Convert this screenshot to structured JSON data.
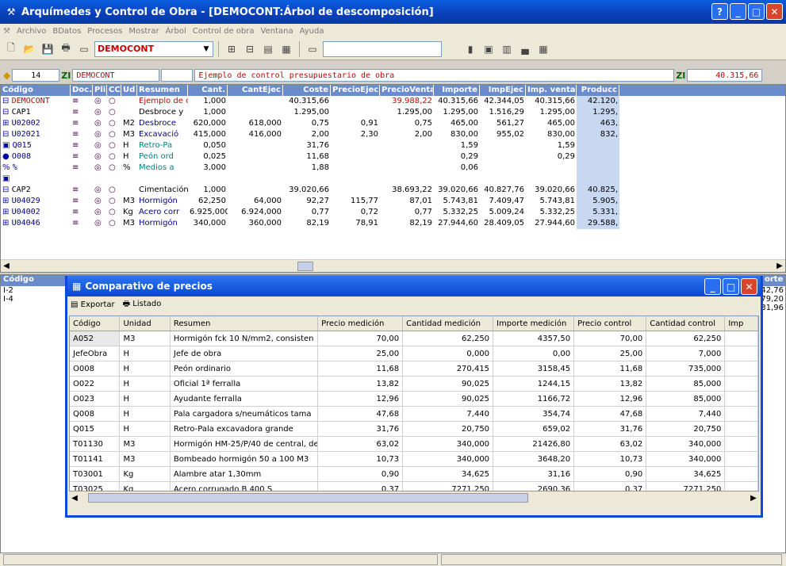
{
  "window": {
    "title": "Arquímedes y Control de Obra - [DEMOCONT:Árbol de descomposición]"
  },
  "menu": [
    "Archivo",
    "BDatos",
    "Procesos",
    "Mostrar",
    "Árbol",
    "Control de obra",
    "Ventana",
    "Ayuda"
  ],
  "toolbar": {
    "project": "DEMOCONT"
  },
  "infobar": {
    "level": "14",
    "code": "DEMOCONT",
    "summary": "Ejemplo de control presupuestario de obra",
    "total": "40.315,66"
  },
  "tree": {
    "columns": [
      "Código",
      "Doc.",
      "Pli.",
      "CC",
      "Ud",
      "Resumen",
      "Cant.",
      "CantEjec",
      "Coste",
      "PrecioEjec",
      "PrecioVenta",
      "Importe",
      "ImpEjec",
      "Imp. venta",
      "Producc"
    ],
    "rows": [
      {
        "code": "DEMOCONT",
        "ud": "",
        "res": "Ejemplo de co",
        "cant": "1,000",
        "cantejec": "",
        "coste": "40.315,66",
        "pe": "",
        "pv": "39.988,22",
        "imp": "40.315,66",
        "impejec": "42.344,05",
        "impv": "40.315,66",
        "prod": "42.120,"
      },
      {
        "code": "CAP1",
        "ud": "",
        "res": "Desbroce y",
        "cant": "1,000",
        "cantejec": "",
        "coste": "1.295,00",
        "pe": "",
        "pv": "1.295,00",
        "imp": "1.295,00",
        "impejec": "1.516,29",
        "impv": "1.295,00",
        "prod": "1.295,"
      },
      {
        "code": "U02002",
        "ud": "M2",
        "res": "Desbroce",
        "cant": "620,000",
        "cantejec": "618,000",
        "coste": "0,75",
        "pe": "0,91",
        "pv": "0,75",
        "imp": "465,00",
        "impejec": "561,27",
        "impv": "465,00",
        "prod": "463,"
      },
      {
        "code": "U02021",
        "ud": "M3",
        "res": "Excavació",
        "cant": "415,000",
        "cantejec": "416,000",
        "coste": "2,00",
        "pe": "2,30",
        "pv": "2,00",
        "imp": "830,00",
        "impejec": "955,02",
        "impv": "830,00",
        "prod": "832,"
      },
      {
        "code": "Q015",
        "ud": "H",
        "res": "Retro-Pa",
        "cant": "0,050",
        "cantejec": "",
        "coste": "31,76",
        "pe": "",
        "pv": "",
        "imp": "1,59",
        "impejec": "",
        "impv": "1,59",
        "prod": ""
      },
      {
        "code": "O008",
        "ud": "H",
        "res": "Peón ord",
        "cant": "0,025",
        "cantejec": "",
        "coste": "11,68",
        "pe": "",
        "pv": "",
        "imp": "0,29",
        "impejec": "",
        "impv": "0,29",
        "prod": ""
      },
      {
        "code": "%",
        "ud": "%",
        "res": "Medios a",
        "cant": "3,000",
        "cantejec": "",
        "coste": "1,88",
        "pe": "",
        "pv": "",
        "imp": "0,06",
        "impejec": "",
        "impv": "",
        "prod": ""
      },
      {
        "code": "",
        "ud": "",
        "res": "",
        "cant": "",
        "cantejec": "",
        "coste": "",
        "pe": "",
        "pv": "",
        "imp": "",
        "impejec": "",
        "impv": "",
        "prod": ""
      },
      {
        "code": "CAP2",
        "ud": "",
        "res": "Cimentación",
        "cant": "1,000",
        "cantejec": "",
        "coste": "39.020,66",
        "pe": "",
        "pv": "38.693,22",
        "imp": "39.020,66",
        "impejec": "40.827,76",
        "impv": "39.020,66",
        "prod": "40.825,"
      },
      {
        "code": "U04029",
        "ud": "M3",
        "res": "Hormigón",
        "cant": "62,250",
        "cantejec": "64,000",
        "coste": "92,27",
        "pe": "115,77",
        "pv": "87,01",
        "imp": "5.743,81",
        "impejec": "7.409,47",
        "impv": "5.743,81",
        "prod": "5.905,"
      },
      {
        "code": "U04002",
        "ud": "Kg",
        "res": "Acero corr",
        "cant": "6.925,000",
        "cantejec": "6.924,000",
        "coste": "0,77",
        "pe": "0,72",
        "pv": "0,77",
        "imp": "5.332,25",
        "impejec": "5.009,24",
        "impv": "5.332,25",
        "prod": "5.331,"
      },
      {
        "code": "U04046",
        "ud": "M3",
        "res": "Hormigón",
        "cant": "340,000",
        "cantejec": "360,000",
        "coste": "82,19",
        "pe": "78,91",
        "pv": "82,19",
        "imp": "27.944,60",
        "impejec": "28.409,05",
        "impv": "27.944,60",
        "prod": "29.588,"
      }
    ]
  },
  "lower": {
    "col_code": "Código",
    "col_imp": "orte",
    "items": [
      "I-2",
      "I-4"
    ],
    "vals": [
      "42,76",
      "79,20",
      "31,96"
    ]
  },
  "dialog": {
    "title": "Comparativo de precios",
    "export": "Exportar",
    "list": "Listado",
    "columns": [
      "Código",
      "Unidad",
      "Resumen",
      "Precio medición",
      "Cantidad medición",
      "Importe medición",
      "Precio control",
      "Cantidad control",
      "Imp"
    ],
    "rows": [
      [
        "A052",
        "M3",
        "Hormigón fck 10 N/mm2, consisten",
        "70,00",
        "62,250",
        "4357,50",
        "70,00",
        "62,250"
      ],
      [
        "JefeObra",
        "H",
        "Jefe de obra",
        "25,00",
        "0,000",
        "0,00",
        "25,00",
        "7,000"
      ],
      [
        "O008",
        "H",
        "Peón ordinario",
        "11,68",
        "270,415",
        "3158,45",
        "11,68",
        "735,000"
      ],
      [
        "O022",
        "H",
        "Oficial 1ª ferralla",
        "13,82",
        "90,025",
        "1244,15",
        "13,82",
        "85,000"
      ],
      [
        "O023",
        "H",
        "Ayudante ferralla",
        "12,96",
        "90,025",
        "1166,72",
        "12,96",
        "85,000"
      ],
      [
        "Q008",
        "H",
        "Pala cargadora s/neumáticos tama",
        "47,68",
        "7,440",
        "354,74",
        "47,68",
        "7,440"
      ],
      [
        "Q015",
        "H",
        "Retro-Pala excavadora grande",
        "31,76",
        "20,750",
        "659,02",
        "31,76",
        "20,750"
      ],
      [
        "T01130",
        "M3",
        "Hormigón HM-25/P/40 de central, de",
        "63,02",
        "340,000",
        "21426,80",
        "63,02",
        "340,000"
      ],
      [
        "T01141",
        "M3",
        "Bombeado hormigón 50 a 100 M3",
        "10,73",
        "340,000",
        "3648,20",
        "10,73",
        "340,000"
      ],
      [
        "T03001",
        "Kg",
        "Alambre atar 1,30mm",
        "0,90",
        "34,625",
        "31,16",
        "0,90",
        "34,625"
      ],
      [
        "T03025",
        "Kg",
        "Acero corrugado B 400 S",
        "0,37",
        "7271,250",
        "2690,36",
        "0,37",
        "7271,250"
      ]
    ]
  }
}
